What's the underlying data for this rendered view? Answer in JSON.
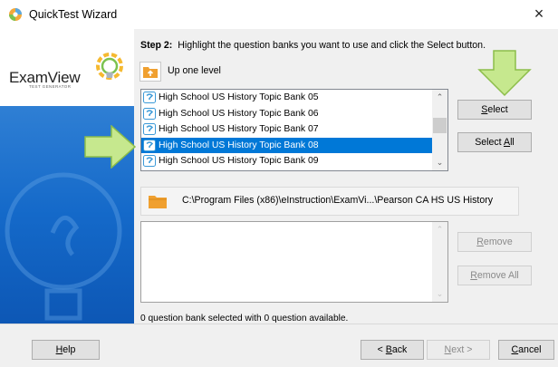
{
  "window": {
    "title": "QuickTest Wizard",
    "close_glyph": "×"
  },
  "logo": {
    "brand": "ExamView",
    "sub": "TEST GENERATOR"
  },
  "step": {
    "label": "Step 2:",
    "text": "Highlight the question banks you want to use and click the Select button."
  },
  "up_level": {
    "label": "Up one level",
    "icon": "folder-up-icon"
  },
  "bank_list": {
    "items": [
      {
        "label": "High School US History Topic Bank 05",
        "selected": false
      },
      {
        "label": "High School US History Topic Bank 06",
        "selected": false
      },
      {
        "label": "High School US History Topic Bank 07",
        "selected": false
      },
      {
        "label": "High School US History Topic Bank 08",
        "selected": true
      },
      {
        "label": "High School US History Topic Bank 09",
        "selected": false
      }
    ],
    "scroll_up": "⌃",
    "scroll_down": "⌄"
  },
  "buttons": {
    "select": {
      "prefix": "",
      "key": "S",
      "rest": "elect"
    },
    "select_all": {
      "prefix": "Select ",
      "key": "A",
      "rest": "ll"
    },
    "remove": {
      "prefix": "",
      "key": "R",
      "rest": "emove"
    },
    "remove_all": {
      "prefix": "",
      "key": "R",
      "rest": "emove All"
    },
    "help": {
      "prefix": "",
      "key": "H",
      "rest": "elp"
    },
    "back": {
      "prefix": "< ",
      "key": "B",
      "rest": "ack"
    },
    "next": {
      "prefix": "",
      "key": "N",
      "rest": "ext >"
    },
    "cancel": {
      "prefix": "",
      "key": "C",
      "rest": "ancel"
    }
  },
  "path": {
    "text": "C:\\Program Files (x86)\\eInstruction\\ExamVi...\\Pearson CA HS US History"
  },
  "selected_list": {
    "scroll_up": "⌃",
    "scroll_down": "⌄"
  },
  "status": {
    "text": "0 question bank selected with 0 question available."
  },
  "colors": {
    "selection": "#0078d7",
    "arrow_fill": "#c6e88e",
    "arrow_stroke": "#8cbd4a",
    "side_blue": "#1469c9"
  },
  "annotations": {
    "arrow_to_select": "arrow-down-icon",
    "arrow_to_item": "arrow-right-icon"
  }
}
